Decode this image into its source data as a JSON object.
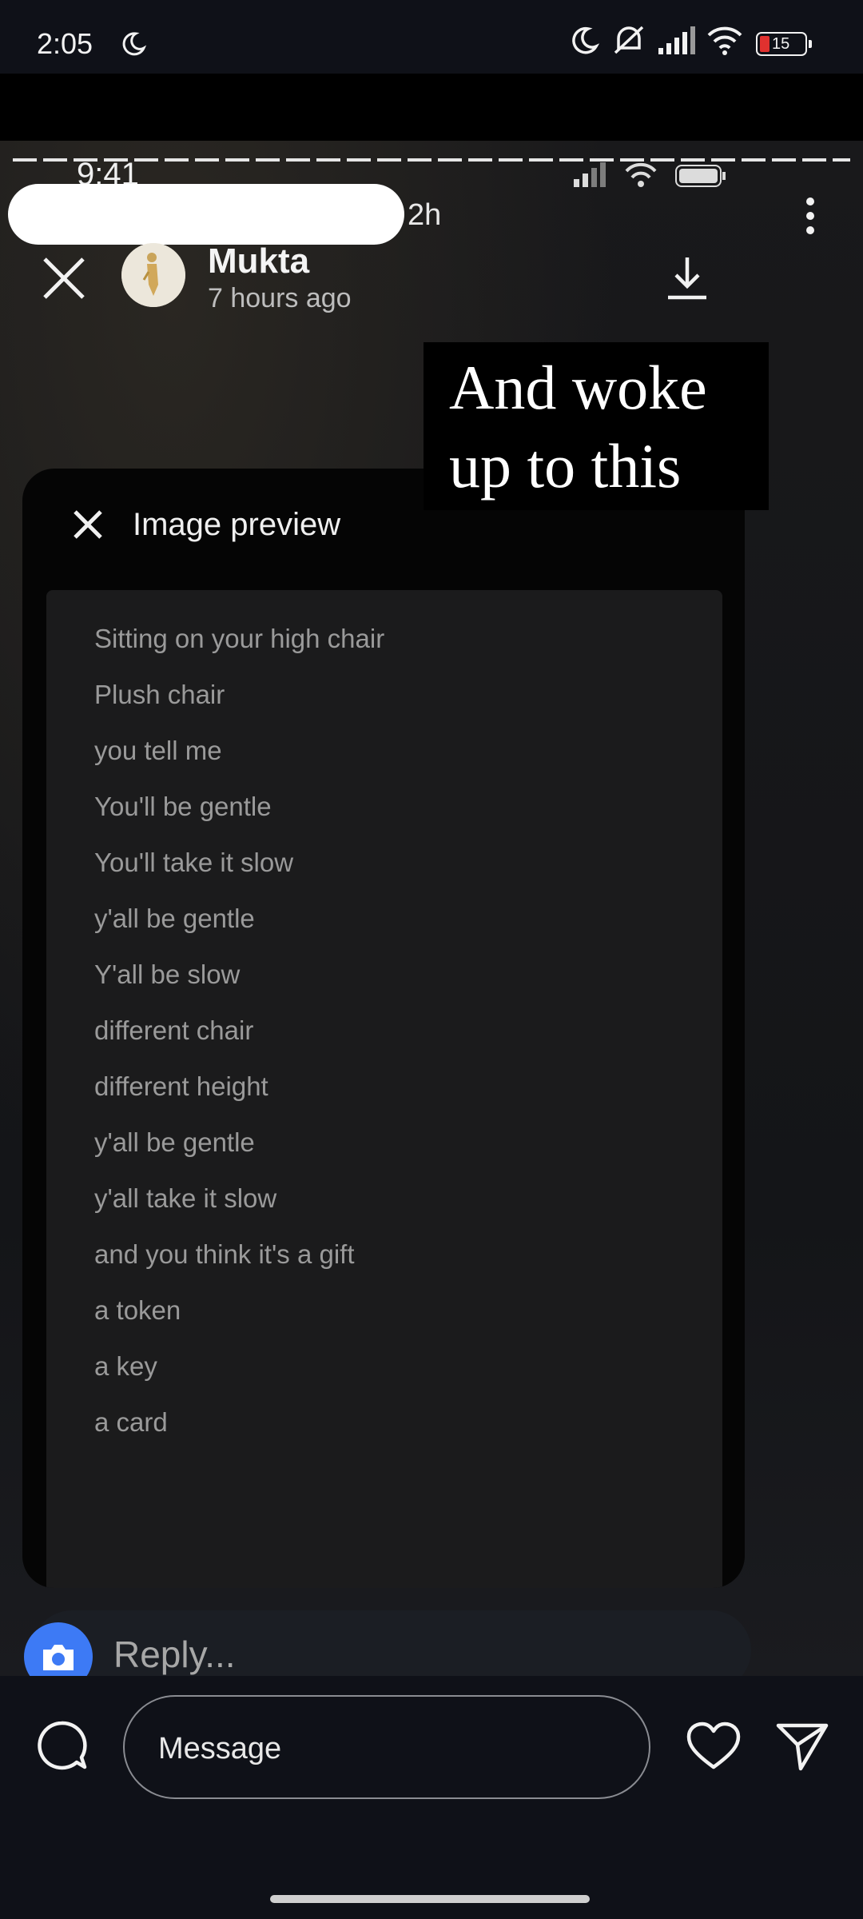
{
  "status_bar": {
    "time": "2:05",
    "battery": "15"
  },
  "story": {
    "inner_time": "9:41",
    "post_age": "2h",
    "username": "Mukta",
    "time_ago": "7 hours ago",
    "caption_lines": [
      "And woke",
      "up to this"
    ],
    "preview": {
      "title": "Image preview",
      "lines": [
        "Sitting on your high chair",
        "Plush chair",
        "you tell me",
        "You'll be gentle",
        "You'll take it slow",
        "y'all be gentle",
        "Y'all be slow",
        "different chair",
        "different height",
        "y'all be gentle",
        "y'all take it slow",
        "and you think it's a gift",
        "a token",
        "a key",
        "a card"
      ]
    },
    "reply_placeholder": "Reply..."
  },
  "bottom_bar": {
    "message_placeholder": "Message"
  },
  "colors": {
    "background": "#0f1118",
    "camera_button": "#3d7af5",
    "battery_low": "#e0312f"
  },
  "icons": [
    "moon-icon",
    "mute-icon",
    "signal-icon",
    "wifi-icon",
    "battery-icon",
    "close-icon",
    "download-icon",
    "more-vertical-icon",
    "camera-icon",
    "chat-bubble-icon",
    "heart-icon",
    "send-icon"
  ]
}
